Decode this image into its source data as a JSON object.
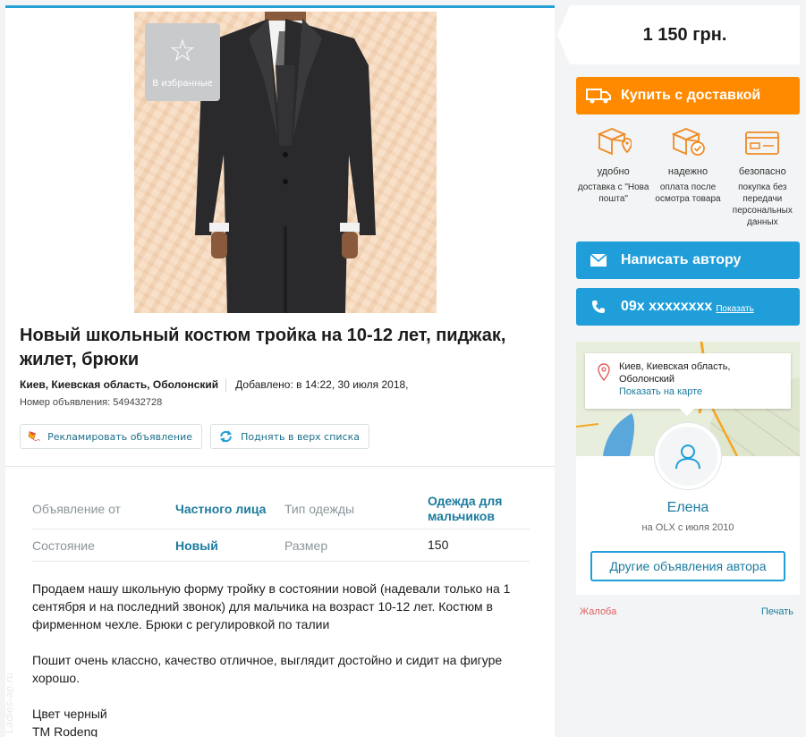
{
  "favorite": {
    "label": "В избранные",
    "icon": "star-icon"
  },
  "listing": {
    "title": "Новый школьный костюм тройка на 10-12 лет, пиджак, жилет, брюки",
    "location": "Киев, Киевская область, Оболонский",
    "added": "Добавлено: в 14:22, 30 июля 2018,",
    "ad_number": "Номер объявления: 549432728"
  },
  "promo": {
    "advertise_label": "Рекламировать объявление",
    "raise_label": "Поднять в верх списка"
  },
  "params": [
    {
      "key": "Объявление от",
      "value": "Частного лица",
      "key2": "Тип одежды",
      "value2": "Одежда для мальчиков"
    },
    {
      "key": "Состояние",
      "value": "Новый",
      "key2": "Размер",
      "value2": "150"
    }
  ],
  "description": [
    "Продаем нашу школьную форму тройку в состоянии новой (надевали только на 1 сентября и на последний звонок) для мальчика на возраст 10-12 лет. Костюм в фирменном чехле. Брюки с регулировкой по талии",
    "Пошит очень классно, качество отличное, выглядит достойно и сидит на фигуре хорошо.",
    "Цвет черный",
    "ТМ Rodeng"
  ],
  "watermark": "Ladies-ap.ru",
  "price": "1 150 грн.",
  "actions": {
    "buy_label": "Купить с доставкой",
    "write_label": "Написать автору",
    "phone_label": "09x xxxxxxxx",
    "phone_show": "Показать"
  },
  "features": [
    {
      "title": "удобно",
      "sub": "доставка с \"Нова пошта\"",
      "icon": "delivery-box-pin-icon"
    },
    {
      "title": "надежно",
      "sub": "оплата после осмотра товара",
      "icon": "box-check-icon"
    },
    {
      "title": "безопасно",
      "sub": "покупка без передачи персональных данных",
      "icon": "card-icon"
    }
  ],
  "seller": {
    "map_location": "Киев, Киевская область, Оболонский",
    "map_link": "Показать на карте",
    "name": "Елена",
    "since": "на OLX с июля 2010",
    "other_ads": "Другие объявления автора"
  },
  "footer_links": {
    "complaint": "Жалоба",
    "print": "Печать"
  },
  "colors": {
    "accent_blue": "#1f9ed9",
    "accent_orange": "#ff8a00",
    "link_blue": "#1c7b9e",
    "complaint_red": "#e05e5e"
  }
}
